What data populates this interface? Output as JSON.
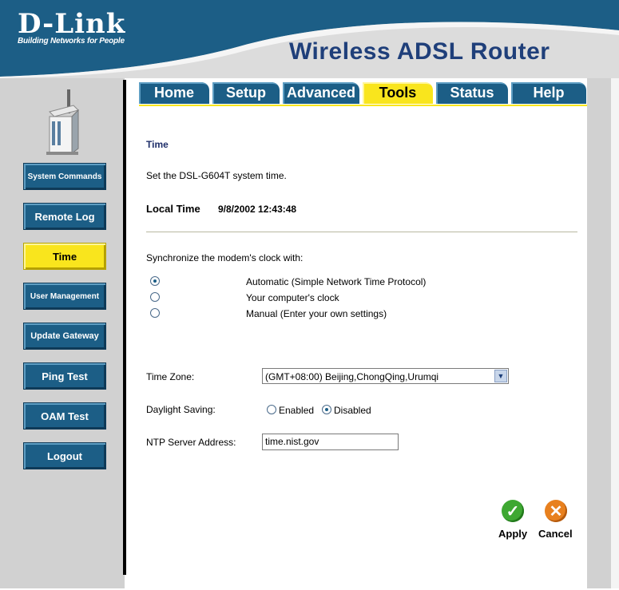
{
  "header": {
    "brand": "D-Link",
    "tagline": "Building Networks for People",
    "product": "Wireless ADSL Router"
  },
  "tabs": [
    {
      "label": "Home",
      "active": false
    },
    {
      "label": "Setup",
      "active": false
    },
    {
      "label": "Advanced",
      "active": false
    },
    {
      "label": "Tools",
      "active": true
    },
    {
      "label": "Status",
      "active": false
    },
    {
      "label": "Help",
      "active": false
    }
  ],
  "sidebar": {
    "items": [
      {
        "label": "System Commands",
        "active": false
      },
      {
        "label": "Remote Log",
        "active": false
      },
      {
        "label": "Time",
        "active": true
      },
      {
        "label": "User Management",
        "active": false
      },
      {
        "label": "Update Gateway",
        "active": false
      },
      {
        "label": "Ping Test",
        "active": false
      },
      {
        "label": "OAM Test",
        "active": false
      },
      {
        "label": "Logout",
        "active": false
      }
    ]
  },
  "page": {
    "title": "Time",
    "description": "Set the DSL-G604T system time.",
    "local_time_label": "Local Time",
    "local_time_value": "9/8/2002 12:43:48",
    "sync_label": "Synchronize the modem's clock with:",
    "sync_options": [
      {
        "label": "Automatic (Simple Network Time Protocol)",
        "selected": true
      },
      {
        "label": "Your computer's clock",
        "selected": false
      },
      {
        "label": "Manual (Enter your own settings)",
        "selected": false
      }
    ],
    "time_zone_label": "Time Zone:",
    "time_zone_value": "(GMT+08:00) Beijing,ChongQing,Urumqi",
    "daylight_label": "Daylight Saving:",
    "daylight_enabled": "Enabled",
    "daylight_disabled": "Disabled",
    "daylight_selected": "Disabled",
    "ntp_label": "NTP Server Address:",
    "ntp_value": "time.nist.gov",
    "apply_label": "Apply",
    "cancel_label": "Cancel"
  },
  "colors": {
    "header_bg": "#1c5e86",
    "tab_bg": "#1c5e86",
    "active_yellow": "#f9e51d",
    "sidebar_bg": "#d1d1d1",
    "title_blue": "#1f3f7a",
    "apply_green": "#3ea832",
    "cancel_orange": "#e8801e"
  },
  "icons": {
    "apply": "check-icon",
    "cancel": "x-icon",
    "select_arrow": "chevron-down-icon",
    "device": "router-device-icon"
  }
}
